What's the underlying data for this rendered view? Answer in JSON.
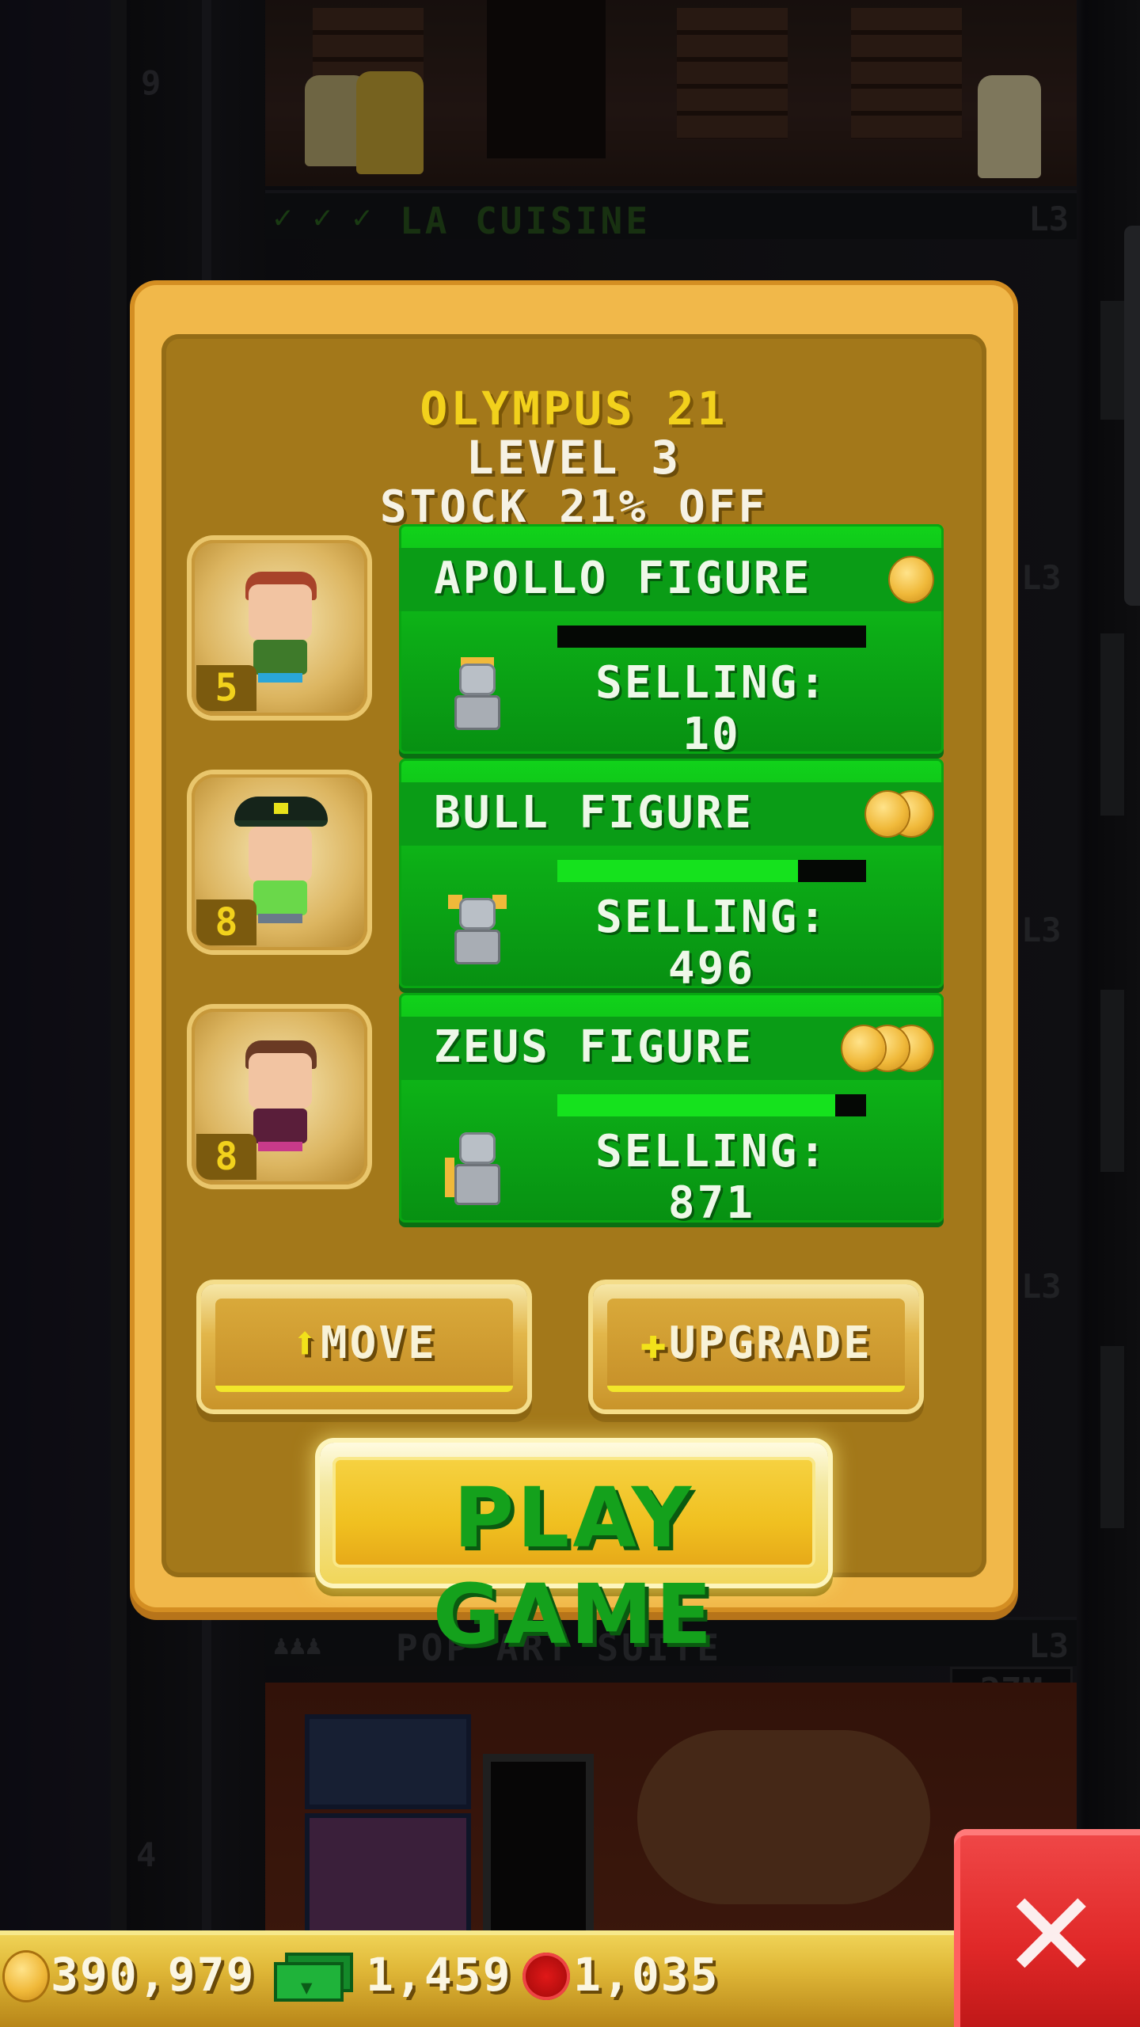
{
  "background": {
    "floor_top": "9",
    "floor_bottom": "4",
    "room_above": {
      "name": "LA CUISINE",
      "level": "L3",
      "status_checks": 3
    },
    "side_levels": [
      "L3",
      "L3",
      "L3"
    ],
    "room_below": {
      "name": "POP ART SUITE",
      "level": "L3",
      "price": "27M"
    }
  },
  "popup": {
    "title": "OLYMPUS 21",
    "level": "LEVEL 3",
    "stock": "STOCK 21% OFF",
    "products": [
      {
        "name": "APOLLO FIGURE",
        "tier": 1,
        "selling_label": "SELLING: 10",
        "progress": 0.0,
        "worker_level": "5",
        "worker": "red-haired-worker"
      },
      {
        "name": "BULL FIGURE",
        "tier": 2,
        "selling_label": "SELLING: 496",
        "progress": 0.78,
        "worker_level": "8",
        "worker": "pirate-hat-worker"
      },
      {
        "name": "ZEUS FIGURE",
        "tier": 3,
        "selling_label": "SELLING: 871",
        "progress": 0.9,
        "worker_level": "8",
        "worker": "brown-haired-worker"
      }
    ],
    "move_label": "MOVE",
    "upgrade_label": "UPGRADE",
    "play_label": "PLAY GAME"
  },
  "hud": {
    "coins": "390,979",
    "bux": "1,459",
    "chips": "1,035"
  },
  "colors": {
    "popup_gold": "#f1b84a",
    "popup_inner": "#a3781a",
    "product_green": "#0cab16",
    "title_yellow": "#f2d11c",
    "close_red": "#e02828"
  }
}
